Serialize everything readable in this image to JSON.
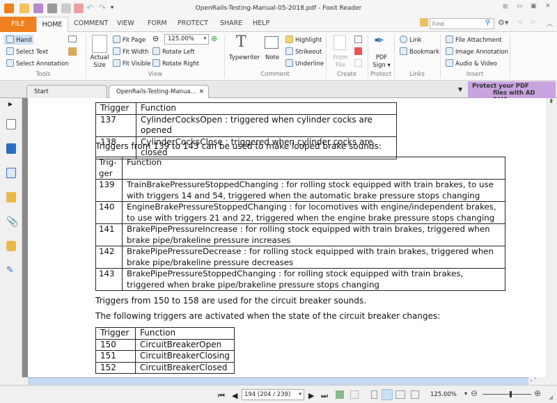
{
  "window": {
    "title": "OpenRails-Testing-Manual-05-2018.pdf - Foxit Reader"
  },
  "menu": {
    "tabs": [
      "FILE",
      "HOME",
      "COMMENT",
      "VIEW",
      "FORM",
      "PROTECT",
      "SHARE",
      "HELP"
    ]
  },
  "search": {
    "placeholder": "Find"
  },
  "ribbon": {
    "tools": {
      "label": "Tools",
      "items": [
        "Hand",
        "Select Text",
        "Select Annotation"
      ]
    },
    "view": {
      "label": "View",
      "actual_size": "Actual Size",
      "items": [
        "Fit Page",
        "Fit Width",
        "Fit Visible",
        "Rotate Left",
        "Rotate Right"
      ],
      "zoom": "125.00%"
    },
    "comment": {
      "label": "Comment",
      "typewriter": "Typewriter",
      "note": "Note",
      "items": [
        "Highlight",
        "Strikeout",
        "Underline"
      ]
    },
    "create": {
      "label": "Create",
      "from_file": "From File"
    },
    "protect": {
      "label": "Protect",
      "pdf_sign": "PDF Sign"
    },
    "links": {
      "label": "Links",
      "items": [
        "Link",
        "Bookmark"
      ]
    },
    "insert": {
      "label": "Insert",
      "items": [
        "File Attachment",
        "Image Annotation",
        "Audio & Video"
      ]
    }
  },
  "doc_tabs": [
    "Start",
    "OpenRails-Testing-Manua..."
  ],
  "ad": {
    "line1": "Protect your PDF",
    "line2": "files with AD RMS"
  },
  "document": {
    "table1": {
      "headers": [
        "Trigger",
        "Function"
      ],
      "rows": [
        [
          "137",
          "CylinderCocksOpen : triggered when cylinder cocks are opened"
        ],
        [
          "138",
          "CylinderCocksClose : triggered when cylinder cocks are closed"
        ]
      ]
    },
    "para1": "Triggers from 139 to 143 can be used to make looped brake sounds:",
    "table2": {
      "headers": [
        "Trig-\nger",
        "Function"
      ],
      "rows": [
        [
          "139",
          "TrainBrakePressureStoppedChanging : for rolling stock equipped with train brakes, to use with triggers 14 and 54, triggered when the automatic brake pressure stops changing"
        ],
        [
          "140",
          "EngineBrakePressureStoppedChanging : for locomotives with engine/independent brakes, to use with triggers 21 and 22, triggered when the engine brake pressure stops changing"
        ],
        [
          "141",
          "BrakePipePressureIncrease : for rolling stock equipped with train brakes, triggered when brake pipe/brakeline pressure increases"
        ],
        [
          "142",
          "BrakePipePressureDecrease : for rolling stock equipped with train brakes, triggered when brake pipe/brakeline pressure decreases"
        ],
        [
          "143",
          "BrakePipePressureStoppedChanging : for rolling stock equipped with train brakes, triggered when brake pipe/brakeline pressure stops changing"
        ]
      ]
    },
    "para2": "Triggers from 150 to 158 are used for the circuit breaker sounds.",
    "para3": "The following triggers are activated when the state of the circuit breaker changes:",
    "table3": {
      "headers": [
        "Trigger",
        "Function"
      ],
      "rows": [
        [
          "150",
          "CircuitBreakerOpen"
        ],
        [
          "151",
          "CircuitBreakerClosing"
        ],
        [
          "152",
          "CircuitBreakerClosed"
        ]
      ]
    }
  },
  "status": {
    "page": "194 (204 / 239)",
    "zoom": "125.00%",
    "zoom_slider_percent": 55
  },
  "colors": {
    "accent": "#f07f1e",
    "ad": "#c9a3e0",
    "scroll": "#c6d9f0"
  }
}
